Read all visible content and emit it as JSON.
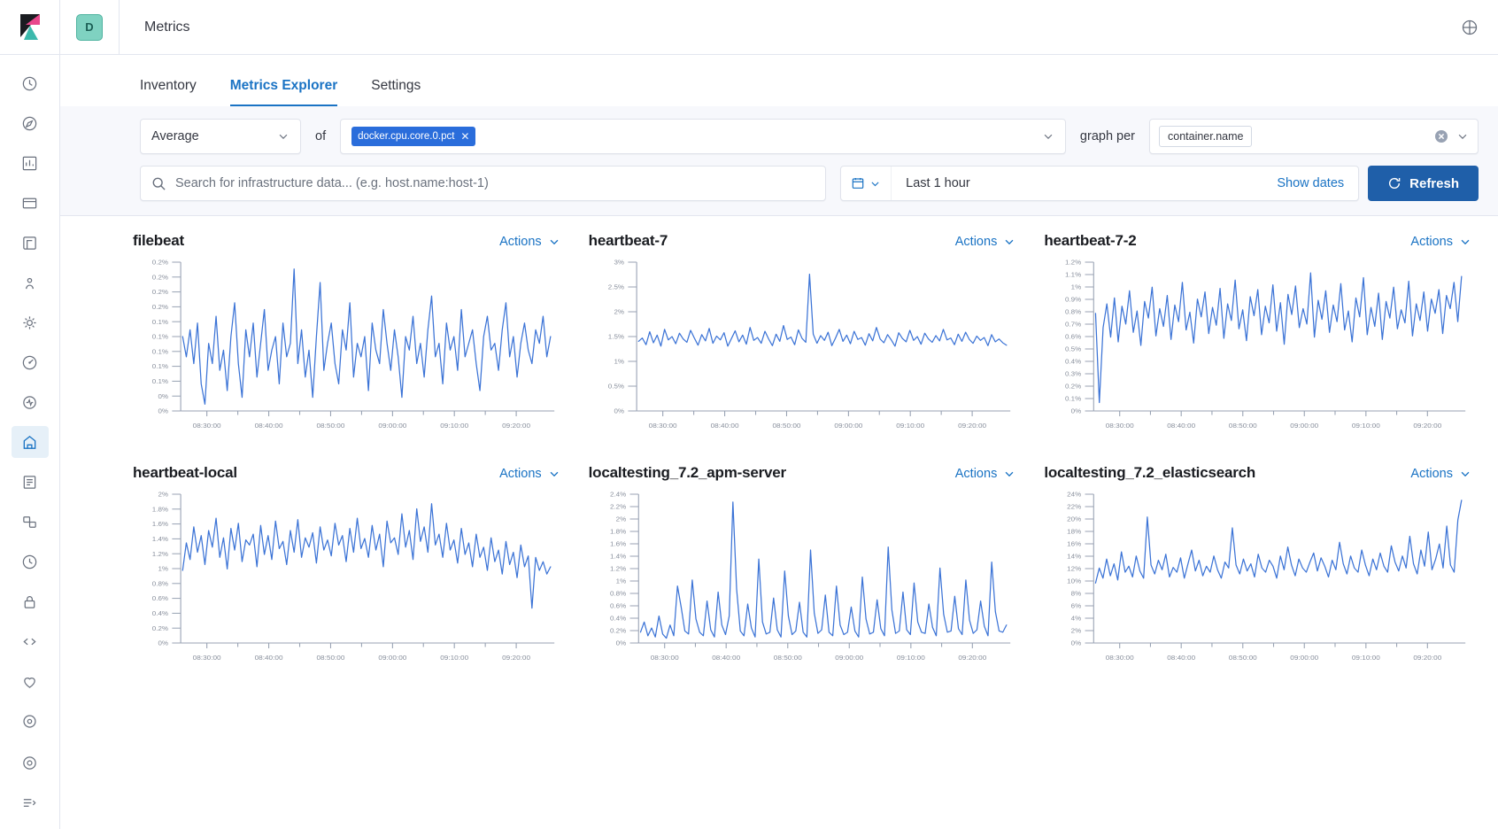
{
  "header": {
    "app_badge_letter": "D",
    "title": "Metrics",
    "logo_icon": "kibana-logo-icon",
    "help_icon": "help-circle-icon"
  },
  "sidebar": {
    "items": [
      {
        "icon": "recently-viewed-icon",
        "active": false
      },
      {
        "icon": "discover-icon",
        "active": false
      },
      {
        "icon": "dashboard-icon",
        "active": false
      },
      {
        "icon": "canvas-icon",
        "active": false
      },
      {
        "icon": "maps-icon",
        "active": false
      },
      {
        "icon": "machine-learning-icon",
        "active": false
      },
      {
        "icon": "infrastructure-icon",
        "active": false
      },
      {
        "icon": "apm-icon",
        "active": false
      },
      {
        "icon": "uptime-icon",
        "active": false
      },
      {
        "icon": "metrics-icon",
        "active": true
      },
      {
        "icon": "logs-icon",
        "active": false
      },
      {
        "icon": "siem-icon",
        "active": false
      },
      {
        "icon": "dev-tools-icon",
        "active": false
      },
      {
        "icon": "security-icon",
        "active": false
      },
      {
        "icon": "code-icon",
        "active": false
      },
      {
        "icon": "monitoring-icon",
        "active": false
      },
      {
        "icon": "management-icon",
        "active": false
      }
    ],
    "bottom_items": [
      {
        "icon": "observability-icon"
      },
      {
        "icon": "collapse-nav-icon"
      }
    ]
  },
  "tabs": [
    {
      "label": "Inventory",
      "active": false
    },
    {
      "label": "Metrics Explorer",
      "active": true
    },
    {
      "label": "Settings",
      "active": false
    }
  ],
  "controls": {
    "aggregation": "Average",
    "of_label": "of",
    "metric_pill": "docker.cpu.core.0.pct",
    "metric_pill_remove_icon": "cross-icon",
    "graph_per_label": "graph per",
    "group_by_pill": "container.name",
    "group_by_clear_icon": "clear-circle-icon",
    "search_placeholder": "Search for infrastructure data... (e.g. host.name:host-1)",
    "search_value": "",
    "search_icon": "search-icon",
    "date_quick_icon": "calendar-icon",
    "date_range": "Last 1 hour",
    "show_dates_label": "Show dates",
    "refresh_label": "Refresh",
    "refresh_icon": "refresh-icon",
    "actions_label": "Actions",
    "caret_icon": "chevron-down-icon"
  },
  "colors": {
    "line": "#3b73d6",
    "accent": "#1a73c4",
    "refresh_button": "#1f5fa9",
    "pill": "#2a6ddb",
    "axis": "#98a2b3",
    "panel_bg": "#f7f8fc"
  },
  "chart_data": [
    {
      "type": "line",
      "title": "filebeat",
      "xlabel": "",
      "ylabel": "",
      "grid": false,
      "legend": "none",
      "xticks": [
        "08:30:00",
        "08:40:00",
        "08:50:00",
        "09:00:00",
        "09:10:00",
        "09:20:00"
      ],
      "yticks": [
        "0.2%",
        "0.2%",
        "0.2%",
        "0.2%",
        "0.1%",
        "0.1%",
        "0.1%",
        "0.1%",
        "0.1%",
        "0%",
        "0%"
      ],
      "ylim": [
        0,
        0.0022
      ],
      "values": [
        0.0011,
        0.0008,
        0.0012,
        0.0007,
        0.0013,
        0.0004,
        0.0001,
        0.001,
        0.0007,
        0.0014,
        0.0006,
        0.0009,
        0.0003,
        0.0011,
        0.0016,
        0.0007,
        0.0002,
        0.0012,
        0.0008,
        0.0013,
        0.0005,
        0.001,
        0.0015,
        0.0006,
        0.0009,
        0.0011,
        0.0004,
        0.0013,
        0.0008,
        0.001,
        0.0021,
        0.0007,
        0.0012,
        0.0005,
        0.0009,
        0.0002,
        0.0011,
        0.0019,
        0.0006,
        0.001,
        0.0013,
        0.0007,
        0.0004,
        0.0012,
        0.0009,
        0.0016,
        0.0005,
        0.001,
        0.0008,
        0.0011,
        0.0003,
        0.0013,
        0.0009,
        0.0007,
        0.0015,
        0.001,
        0.0006,
        0.0012,
        0.0008,
        0.0002,
        0.0011,
        0.0009,
        0.0014,
        0.0007,
        0.001,
        0.0005,
        0.0012,
        0.0017,
        0.0008,
        0.001,
        0.0004,
        0.0013,
        0.0009,
        0.0011,
        0.0006,
        0.0015,
        0.0008,
        0.001,
        0.0012,
        0.0007,
        0.0003,
        0.0011,
        0.0014,
        0.0009,
        0.001,
        0.0006,
        0.0012,
        0.0016,
        0.0008,
        0.0011,
        0.0005,
        0.001,
        0.0013,
        0.0009,
        0.0007,
        0.0012,
        0.001,
        0.0014,
        0.0008,
        0.0011
      ],
      "x_start_frac": 0.0,
      "x_end_frac": 1.0
    },
    {
      "type": "line",
      "title": "heartbeat-7",
      "xlabel": "",
      "ylabel": "",
      "grid": false,
      "legend": "none",
      "xticks": [
        "08:30:00",
        "08:40:00",
        "08:50:00",
        "09:00:00",
        "09:10:00",
        "09:20:00"
      ],
      "yticks": [
        "3%",
        "2.5%",
        "2%",
        "1.5%",
        "1%",
        "0.5%",
        "0%"
      ],
      "ylim": [
        0,
        0.031
      ],
      "values": [
        0.0145,
        0.0152,
        0.0138,
        0.0165,
        0.0142,
        0.0158,
        0.0135,
        0.017,
        0.0148,
        0.0155,
        0.014,
        0.0162,
        0.015,
        0.0143,
        0.0168,
        0.0152,
        0.0137,
        0.0159,
        0.0146,
        0.0172,
        0.0141,
        0.0156,
        0.0148,
        0.0163,
        0.0135,
        0.0151,
        0.0167,
        0.0144,
        0.0158,
        0.0139,
        0.0174,
        0.0147,
        0.0153,
        0.0141,
        0.0166,
        0.015,
        0.0136,
        0.016,
        0.0145,
        0.0178,
        0.0149,
        0.0154,
        0.0138,
        0.0169,
        0.0151,
        0.0143,
        0.0285,
        0.016,
        0.0141,
        0.0157,
        0.0147,
        0.0164,
        0.0136,
        0.0152,
        0.017,
        0.0145,
        0.0158,
        0.014,
        0.0166,
        0.0149,
        0.0153,
        0.0137,
        0.0161,
        0.0146,
        0.0174,
        0.015,
        0.0142,
        0.0159,
        0.0148,
        0.0135,
        0.0163,
        0.0151,
        0.0144,
        0.0168,
        0.0147,
        0.0155,
        0.0139,
        0.0162,
        0.015,
        0.0143,
        0.0157,
        0.0146,
        0.017,
        0.0148,
        0.0152,
        0.0138,
        0.016,
        0.0145,
        0.0164,
        0.0149,
        0.0141,
        0.0156,
        0.0147,
        0.0153,
        0.0136,
        0.0159,
        0.0144,
        0.015,
        0.0142,
        0.0137
      ],
      "x_start_frac": 0.0,
      "x_end_frac": 1.0
    },
    {
      "type": "line",
      "title": "heartbeat-7-2",
      "xlabel": "",
      "ylabel": "",
      "grid": false,
      "legend": "none",
      "xticks": [
        "08:30:00",
        "08:40:00",
        "08:50:00",
        "09:00:00",
        "09:10:00",
        "09:20:00"
      ],
      "yticks": [
        "1.2%",
        "1.1%",
        "1%",
        "0.9%",
        "0.8%",
        "0.7%",
        "0.6%",
        "0.5%",
        "0.4%",
        "0.3%",
        "0.2%",
        "0.1%",
        "0%"
      ],
      "ylim": [
        0,
        0.0125
      ],
      "values": [
        0.0082,
        0.0007,
        0.007,
        0.009,
        0.0062,
        0.0095,
        0.0058,
        0.0088,
        0.0073,
        0.0101,
        0.0066,
        0.0084,
        0.0055,
        0.0092,
        0.0078,
        0.0104,
        0.0063,
        0.0086,
        0.0071,
        0.0097,
        0.006,
        0.0089,
        0.0075,
        0.0108,
        0.0068,
        0.0083,
        0.0057,
        0.0094,
        0.0079,
        0.01,
        0.0065,
        0.0087,
        0.0072,
        0.0103,
        0.0061,
        0.009,
        0.0076,
        0.011,
        0.0069,
        0.0085,
        0.0059,
        0.0096,
        0.008,
        0.0102,
        0.0064,
        0.0088,
        0.0074,
        0.0106,
        0.0067,
        0.0091,
        0.0056,
        0.0098,
        0.0081,
        0.0105,
        0.007,
        0.0086,
        0.0073,
        0.0116,
        0.0062,
        0.0093,
        0.0077,
        0.0101,
        0.0066,
        0.0089,
        0.0075,
        0.0107,
        0.0068,
        0.0084,
        0.0058,
        0.0095,
        0.0079,
        0.0112,
        0.0064,
        0.0087,
        0.0071,
        0.0099,
        0.006,
        0.0092,
        0.0078,
        0.0104,
        0.0069,
        0.0085,
        0.0074,
        0.0109,
        0.0063,
        0.009,
        0.0076,
        0.01,
        0.0067,
        0.0094,
        0.0082,
        0.0102,
        0.0065,
        0.0097,
        0.0086,
        0.0108,
        0.0075,
        0.0113
      ],
      "x_start_frac": 0.0,
      "x_end_frac": 1.0
    },
    {
      "type": "line",
      "title": "heartbeat-local",
      "xlabel": "",
      "ylabel": "",
      "grid": false,
      "legend": "none",
      "xticks": [
        "08:30:00",
        "08:40:00",
        "08:50:00",
        "09:00:00",
        "09:10:00",
        "09:20:00"
      ],
      "yticks": [
        "2%",
        "1.8%",
        "1.6%",
        "1.4%",
        "1.2%",
        "1%",
        "0.8%",
        "0.6%",
        "0.4%",
        "0.2%",
        "0%"
      ],
      "ylim": [
        0,
        0.0205
      ],
      "values": [
        0.01,
        0.0138,
        0.0115,
        0.016,
        0.0125,
        0.0148,
        0.0108,
        0.0155,
        0.0132,
        0.0172,
        0.0118,
        0.0145,
        0.0102,
        0.0158,
        0.0128,
        0.0165,
        0.0112,
        0.0142,
        0.0135,
        0.015,
        0.0105,
        0.0162,
        0.0122,
        0.0148,
        0.0115,
        0.0168,
        0.013,
        0.014,
        0.0108,
        0.0155,
        0.0125,
        0.017,
        0.0118,
        0.0145,
        0.0132,
        0.0152,
        0.011,
        0.016,
        0.0128,
        0.0142,
        0.012,
        0.0165,
        0.0135,
        0.0148,
        0.0112,
        0.0158,
        0.0125,
        0.0172,
        0.013,
        0.0144,
        0.0118,
        0.0162,
        0.0128,
        0.015,
        0.0105,
        0.0168,
        0.0138,
        0.0145,
        0.0122,
        0.0178,
        0.0132,
        0.0155,
        0.0115,
        0.0185,
        0.014,
        0.016,
        0.0125,
        0.0192,
        0.0135,
        0.015,
        0.0118,
        0.0165,
        0.0128,
        0.0142,
        0.011,
        0.0158,
        0.0122,
        0.0138,
        0.0105,
        0.015,
        0.0118,
        0.0132,
        0.01,
        0.0145,
        0.0112,
        0.0128,
        0.0095,
        0.014,
        0.0108,
        0.0125,
        0.009,
        0.0135,
        0.0105,
        0.012,
        0.0048,
        0.0118,
        0.01,
        0.0112,
        0.0095,
        0.0105
      ],
      "x_start_frac": 0.0,
      "x_end_frac": 1.0
    },
    {
      "type": "line",
      "title": "localtesting_7.2_apm-server",
      "xlabel": "",
      "ylabel": "",
      "grid": false,
      "legend": "none",
      "xticks": [
        "08:30:00",
        "08:40:00",
        "08:50:00",
        "09:00:00",
        "09:10:00",
        "09:20:00"
      ],
      "yticks": [
        "2.4%",
        "2.2%",
        "2%",
        "1.8%",
        "1.6%",
        "1.4%",
        "1.2%",
        "1%",
        "0.8%",
        "0.6%",
        "0.4%",
        "0.2%",
        "0%"
      ],
      "ylim": [
        0,
        0.0248
      ],
      "values": [
        0.0018,
        0.0035,
        0.0012,
        0.0025,
        0.001,
        0.0045,
        0.0015,
        0.0008,
        0.003,
        0.0012,
        0.0095,
        0.006,
        0.002,
        0.0015,
        0.0105,
        0.004,
        0.0018,
        0.0012,
        0.007,
        0.0022,
        0.001,
        0.0085,
        0.003,
        0.0014,
        0.0045,
        0.0235,
        0.009,
        0.002,
        0.0012,
        0.0065,
        0.0025,
        0.001,
        0.014,
        0.0035,
        0.0015,
        0.0018,
        0.0075,
        0.0022,
        0.001,
        0.012,
        0.0045,
        0.0014,
        0.002,
        0.0068,
        0.0018,
        0.001,
        0.0155,
        0.005,
        0.0016,
        0.0022,
        0.008,
        0.0018,
        0.0012,
        0.0095,
        0.003,
        0.0014,
        0.0018,
        0.006,
        0.002,
        0.001,
        0.011,
        0.004,
        0.0015,
        0.0018,
        0.0072,
        0.0024,
        0.0012,
        0.016,
        0.0055,
        0.0016,
        0.002,
        0.0085,
        0.0022,
        0.0014,
        0.01,
        0.0035,
        0.0018,
        0.0016,
        0.0065,
        0.0026,
        0.0012,
        0.0125,
        0.0048,
        0.0018,
        0.002,
        0.0078,
        0.0024,
        0.0014,
        0.0105,
        0.0038,
        0.0016,
        0.0022,
        0.007,
        0.0028,
        0.0012,
        0.0135,
        0.0052,
        0.002,
        0.0018,
        0.003
      ],
      "x_start_frac": 0.0,
      "x_end_frac": 1.0
    },
    {
      "type": "line",
      "title": "localtesting_7.2_elasticsearch",
      "xlabel": "",
      "ylabel": "",
      "grid": false,
      "legend": "none",
      "xticks": [
        "08:30:00",
        "08:40:00",
        "08:50:00",
        "09:00:00",
        "09:10:00",
        "09:20:00"
      ],
      "yticks": [
        "24%",
        "22%",
        "20%",
        "18%",
        "16%",
        "14%",
        "12%",
        "10%",
        "8%",
        "6%",
        "4%",
        "2%",
        "0%"
      ],
      "ylim": [
        0,
        0.248
      ],
      "values": [
        0.1,
        0.125,
        0.108,
        0.14,
        0.112,
        0.132,
        0.105,
        0.152,
        0.118,
        0.128,
        0.11,
        0.145,
        0.12,
        0.108,
        0.21,
        0.13,
        0.115,
        0.138,
        0.122,
        0.148,
        0.11,
        0.126,
        0.118,
        0.142,
        0.108,
        0.132,
        0.155,
        0.12,
        0.138,
        0.112,
        0.128,
        0.118,
        0.145,
        0.122,
        0.108,
        0.135,
        0.125,
        0.192,
        0.13,
        0.115,
        0.14,
        0.12,
        0.132,
        0.11,
        0.148,
        0.125,
        0.118,
        0.138,
        0.128,
        0.108,
        0.145,
        0.122,
        0.16,
        0.13,
        0.112,
        0.14,
        0.125,
        0.118,
        0.135,
        0.15,
        0.12,
        0.142,
        0.128,
        0.11,
        0.138,
        0.122,
        0.168,
        0.132,
        0.115,
        0.145,
        0.125,
        0.118,
        0.155,
        0.13,
        0.112,
        0.14,
        0.122,
        0.15,
        0.128,
        0.118,
        0.162,
        0.135,
        0.12,
        0.145,
        0.125,
        0.178,
        0.132,
        0.115,
        0.155,
        0.128,
        0.185,
        0.122,
        0.14,
        0.165,
        0.125,
        0.195,
        0.13,
        0.118,
        0.205,
        0.238
      ],
      "x_start_frac": 0.0,
      "x_end_frac": 1.0
    }
  ]
}
